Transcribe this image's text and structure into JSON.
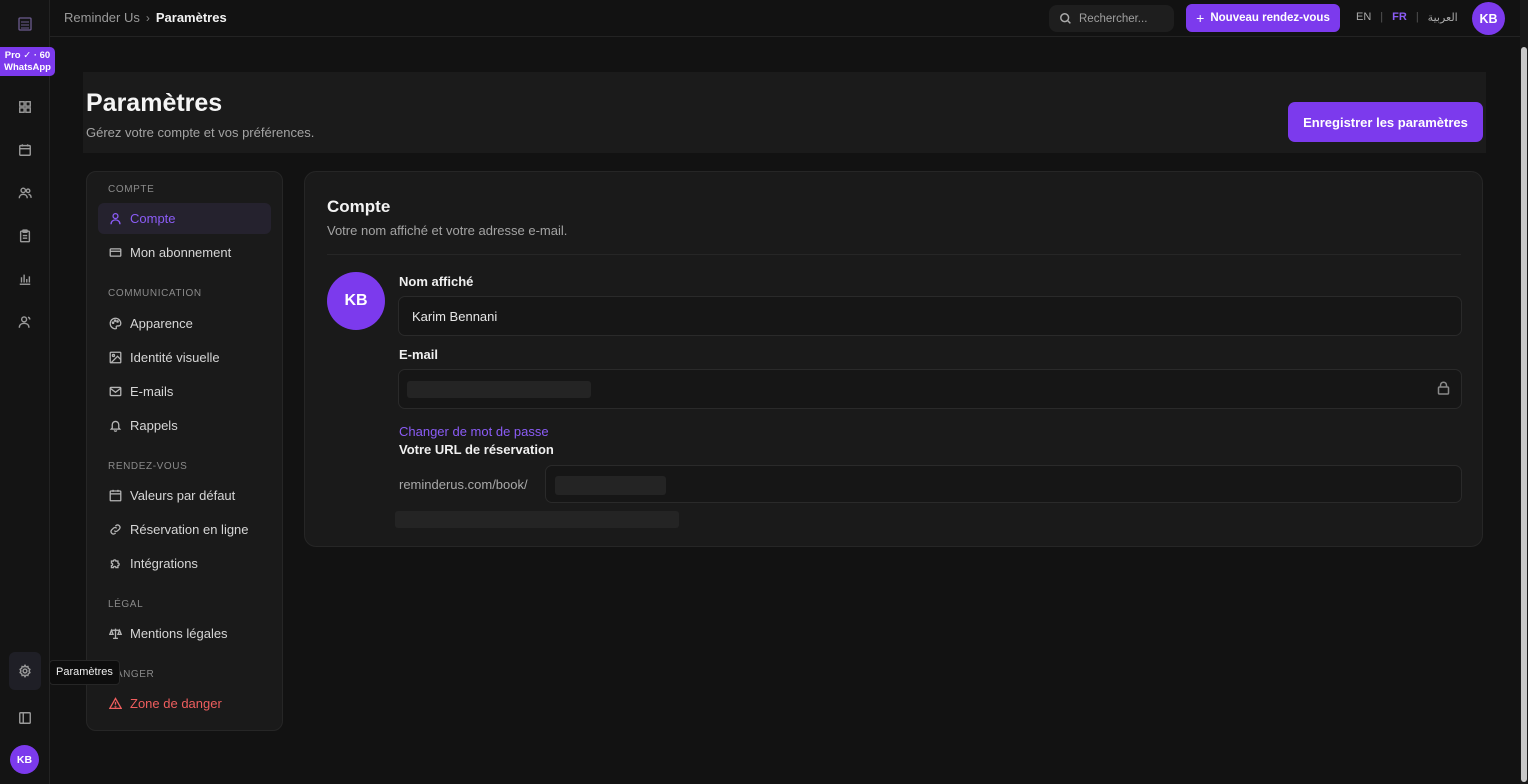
{
  "rail": {
    "badge_line1": "Pro ✓ · 60",
    "badge_line2": "WhatsApp",
    "tooltip": "Paramètres",
    "avatar_initials": "KB",
    "icons": [
      "dashboard-icon",
      "calendar-icon",
      "users-icon",
      "clipboard-icon",
      "bar-chart-icon",
      "user-icon",
      "settings-icon",
      "panel-toggle-icon"
    ]
  },
  "topbar": {
    "breadcrumb_root": "Reminder Us",
    "breadcrumb_sep": "›",
    "breadcrumb_current": "Paramètres",
    "search_placeholder": "Rechercher...",
    "new_appointment_label": "Nouveau rendez-vous",
    "languages": {
      "en": "EN",
      "fr": "FR",
      "ar": "العربية",
      "sep": "|"
    },
    "active_language": "FR",
    "avatar_initials": "KB"
  },
  "header": {
    "title": "Paramètres",
    "subtitle": "Gérez votre compte et vos préférences.",
    "save_label": "Enregistrer les paramètres"
  },
  "settings_nav": {
    "sections": {
      "account": "COMPTE",
      "communication": "COMMUNICATION",
      "appointments": "RENDEZ-VOUS",
      "legal": "LÉGAL",
      "danger": "DANGER"
    },
    "items": {
      "account": "Compte",
      "subscription": "Mon abonnement",
      "appearance": "Apparence",
      "branding": "Identité visuelle",
      "emails": "E-mails",
      "reminders": "Rappels",
      "defaults": "Valeurs par défaut",
      "online_booking": "Réservation en ligne",
      "integrations": "Intégrations",
      "legal_notice": "Mentions légales",
      "danger_zone": "Zone de danger"
    }
  },
  "account_card": {
    "title": "Compte",
    "subtitle": "Votre nom affiché et votre adresse e-mail.",
    "avatar_initials": "KB",
    "display_name_label": "Nom affiché",
    "display_name_value": "Karim Bennani",
    "email_label": "E-mail",
    "change_password_link": "Changer de mot de passe",
    "booking_url_label": "Votre URL de réservation",
    "booking_url_prefix": "reminderus.com/book/"
  },
  "colors": {
    "accent": "#7c3aed",
    "accent_text": "#8b5cf6",
    "danger": "#ef5e5e",
    "background": "#121212",
    "panel": "#1a1a1a"
  }
}
